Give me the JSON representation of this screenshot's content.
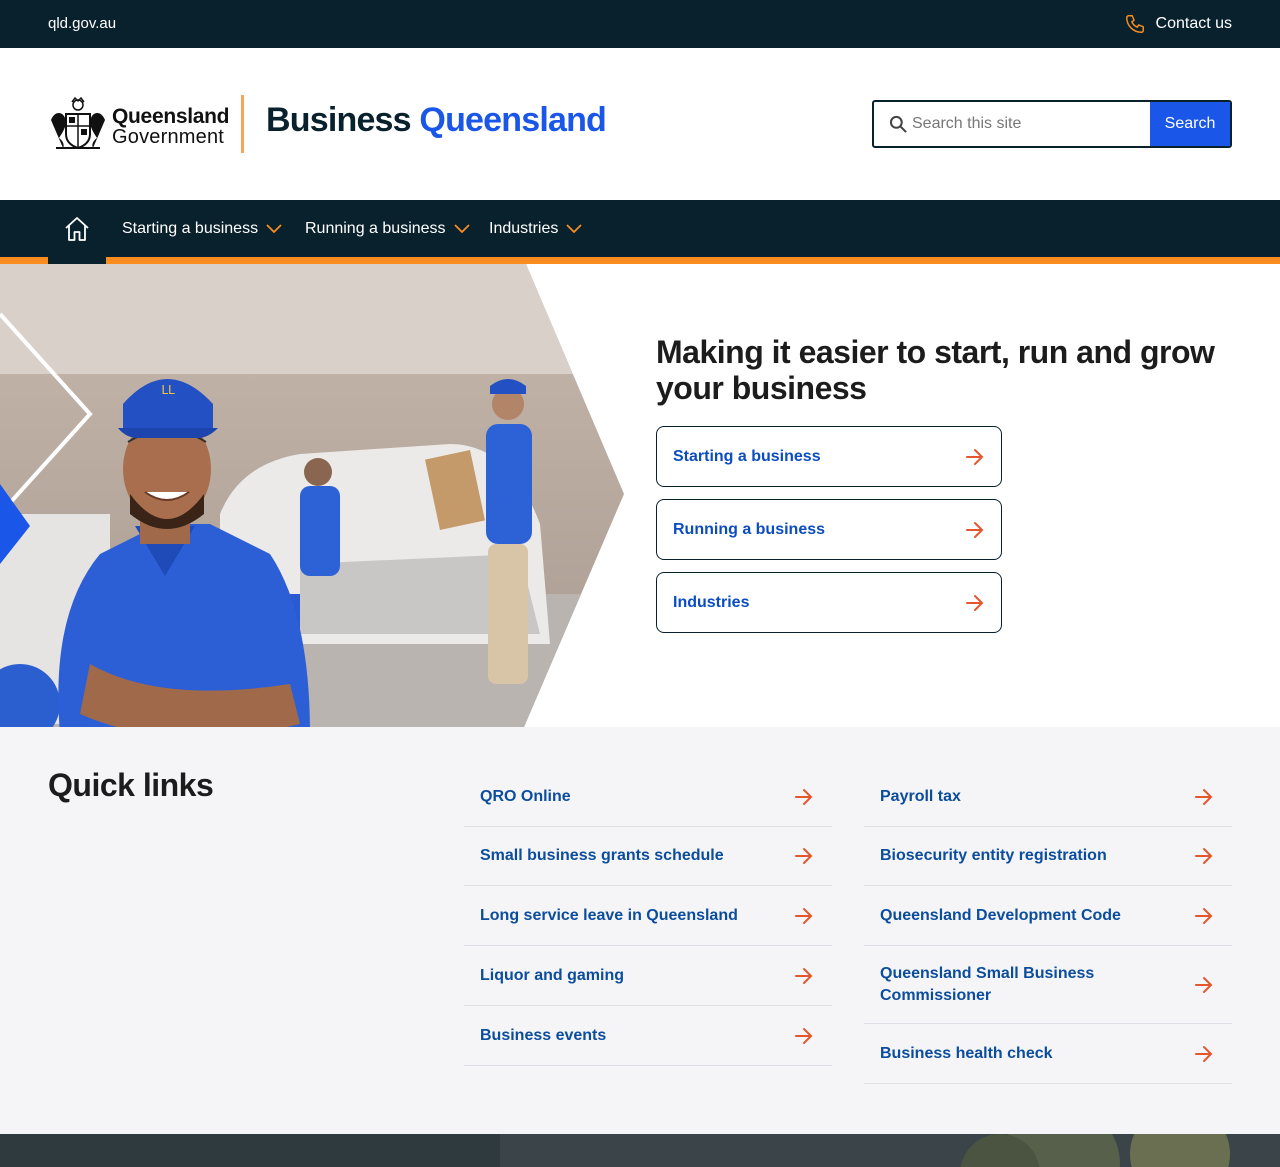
{
  "topbar": {
    "gov_link": "qld.gov.au",
    "contact_label": "Contact us",
    "contact_icon": "phone-icon",
    "icon_color": "#f98c1f"
  },
  "header": {
    "logo_line1": "Queensland",
    "logo_line2": "Government",
    "brand_part1": "Business ",
    "brand_part2": "Queensland",
    "search": {
      "placeholder": "Search this site",
      "button_label": "Search"
    }
  },
  "nav": {
    "home_icon": "home-icon",
    "items": [
      {
        "label": "Starting a business"
      },
      {
        "label": "Running a business"
      },
      {
        "label": "Industries"
      }
    ]
  },
  "hero": {
    "heading": "Making it easier to start, run and grow your business",
    "buttons": [
      {
        "label": "Starting a business"
      },
      {
        "label": "Running a business"
      },
      {
        "label": "Industries"
      }
    ]
  },
  "quick_links": {
    "title": "Quick links",
    "left": [
      {
        "label": "QRO Online"
      },
      {
        "label": "Small business grants schedule"
      },
      {
        "label": "Long service leave in Queensland"
      },
      {
        "label": "Liquor and gaming"
      },
      {
        "label": "Business events"
      }
    ],
    "right": [
      {
        "label": "Payroll tax"
      },
      {
        "label": "Biosecurity entity registration"
      },
      {
        "label": "Queensland Development Code"
      },
      {
        "label": "Queensland Small Business Commissioner"
      },
      {
        "label": "Business health check"
      }
    ]
  },
  "colors": {
    "dark": "#09212c",
    "accent": "#f98c1f",
    "brand_blue": "#1a56e8",
    "link": "#0b4d9c",
    "arrow": "#e4572e"
  }
}
